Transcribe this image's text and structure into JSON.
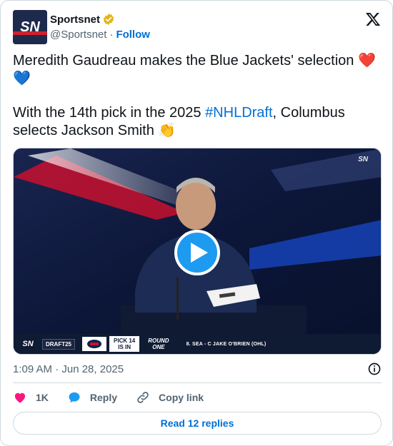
{
  "account": {
    "display_name": "Sportsnet",
    "handle": "@Sportsnet",
    "separator": "·",
    "follow_label": "Follow",
    "avatar_text": "SN",
    "verified_color": "#e2b719"
  },
  "tweet": {
    "line1": "Meredith Gaudreau makes the Blue Jackets' selection",
    "emoji_heart_red": "❤️",
    "emoji_heart_blue": "💙",
    "line2_before": "With the 14th pick in the 2025 ",
    "hashtag": "#NHLDraft",
    "line2_after": ", Columbus selects Jackson Smith ",
    "emoji_clap": "👏"
  },
  "media": {
    "watermark": "SN",
    "ticker": {
      "network": "SN",
      "draft_badge": "DRAFT25",
      "pick_label_1": "PICK 14",
      "pick_label_2": "IS IN",
      "round_1": "ROUND",
      "round_2": "ONE",
      "next_pick": "8. SEA - C JAKE O'BRIEN (OHL)"
    }
  },
  "meta": {
    "timestamp": "1:09 AM · Jun 28, 2025"
  },
  "actions": {
    "like_count": "1K",
    "reply_label": "Reply",
    "copy_label": "Copy link"
  },
  "footer": {
    "read_replies": "Read 12 replies"
  },
  "colors": {
    "accent": "#006fd6",
    "play": "#1d9bf0",
    "like": "#f91880"
  }
}
